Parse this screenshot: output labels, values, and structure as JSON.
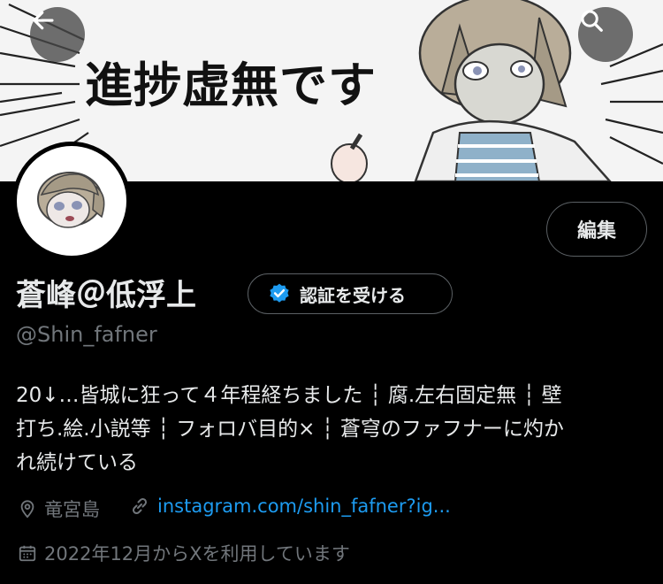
{
  "banner": {
    "text": "進捗虚無です"
  },
  "nav": {
    "back_icon": "arrow-left-icon",
    "search_icon": "search-icon"
  },
  "profile": {
    "edit_label": "編集",
    "name": "蒼峰＠低浮上",
    "verify_label": "認証を受ける",
    "handle": "@Shin_fafner",
    "bio_lines": [
      "20↓…皆城に狂って４年程経ちました ┆ 腐.左右固定無 ┆ 壁",
      "打ち.絵.小説等 ┆ フォロバ目的× ┆ 蒼穹のファフナーに灼か",
      "れ続けている"
    ],
    "location": "竜宮島",
    "link": "instagram.com/shin_fafner?ig...",
    "joined": "2022年12月からXを利用しています"
  },
  "colors": {
    "accent": "#1d9bf0",
    "muted": "#71767b",
    "background": "#000000"
  }
}
